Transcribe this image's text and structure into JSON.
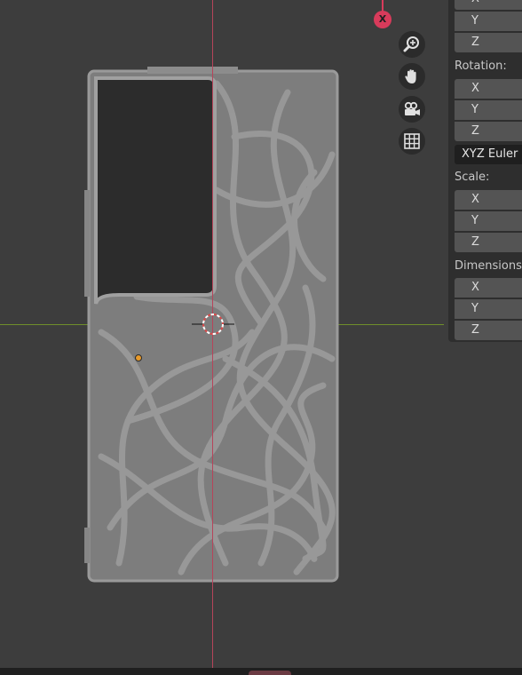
{
  "gizmo": {
    "x_axis_label": "X"
  },
  "tools": {
    "zoom_icon": "zoom-in-icon",
    "pan_icon": "hand-icon",
    "camera_icon": "camera-icon",
    "grid_icon": "grid-icon"
  },
  "panel": {
    "location": {
      "y": "Y",
      "z": "Z",
      "x_partial": "X"
    },
    "rotation": {
      "label": "Rotation:",
      "x": "X",
      "y": "Y",
      "z": "Z",
      "mode": "XYZ Euler"
    },
    "scale": {
      "label": "Scale:",
      "x": "X",
      "y": "Y",
      "z": "Z"
    },
    "dimensions": {
      "label": "Dimensions:",
      "x": "X",
      "y": "Y",
      "z": "Z"
    }
  },
  "colors": {
    "background": "#3d3d3d",
    "x_axis": "#b6445a",
    "y_axis": "#6f8f2a",
    "mesh": "#8a8a8a",
    "origin": "#e89a2a"
  }
}
